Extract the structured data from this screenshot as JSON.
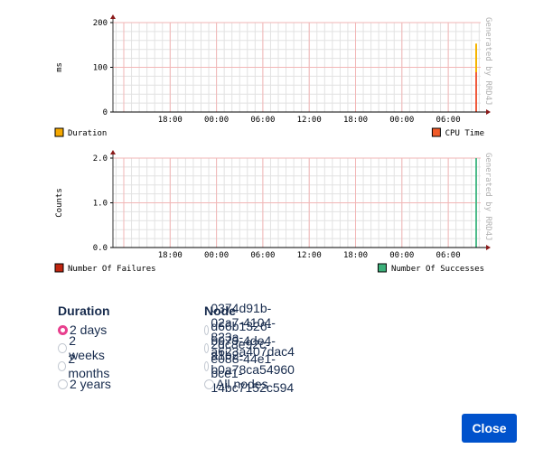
{
  "chart_data": [
    {
      "type": "line",
      "title": "",
      "ylabel": "ms",
      "xlabel": "",
      "ylim": [
        0,
        200
      ],
      "yticks": [
        "0",
        "100",
        "200"
      ],
      "xticks": [
        "18:00",
        "00:00",
        "06:00",
        "12:00",
        "18:00",
        "00:00",
        "06:00"
      ],
      "watermark": "Generated by RRD4J",
      "series": [
        {
          "name": "Duration",
          "color": "#f5b400",
          "points": [
            {
              "x": "latest",
              "y": 153
            }
          ]
        },
        {
          "name": "CPU Time",
          "color": "#f05a3c",
          "points": [
            {
              "x": "latest",
              "y": 89
            }
          ]
        }
      ],
      "legend": [
        {
          "label": "Duration",
          "color": "#f5a800",
          "position": "bottom-left"
        },
        {
          "label": "CPU Time",
          "color": "#f05a28",
          "position": "bottom-right"
        }
      ],
      "grid": true
    },
    {
      "type": "line",
      "title": "",
      "ylabel": "Counts",
      "xlabel": "",
      "ylim": [
        0,
        2
      ],
      "yticks": [
        "0.0",
        "1.0",
        "2.0"
      ],
      "xticks": [
        "18:00",
        "00:00",
        "06:00",
        "12:00",
        "18:00",
        "00:00",
        "06:00"
      ],
      "watermark": "Generated by RRD4J",
      "series": [
        {
          "name": "Number Of Failures",
          "color": "#c0250f",
          "points": [
            {
              "x": "latest",
              "y": 0
            }
          ]
        },
        {
          "name": "Number Of Successes",
          "color": "#4dbb8a",
          "points": [
            {
              "x": "latest",
              "y": 2
            }
          ]
        }
      ],
      "legend": [
        {
          "label": "Number Of Failures",
          "color": "#c0250f",
          "position": "bottom-left"
        },
        {
          "label": "Number Of Successes",
          "color": "#3cb07a",
          "position": "bottom-right"
        }
      ],
      "grid": true
    }
  ],
  "duration": {
    "heading": "Duration",
    "options": [
      {
        "label": "2 days",
        "selected": true
      },
      {
        "label": "2 weeks",
        "selected": false
      },
      {
        "label": "2 months",
        "selected": false
      },
      {
        "label": "2 years",
        "selected": false
      }
    ]
  },
  "node": {
    "heading": "Node",
    "options": [
      {
        "label": "0374d91b-02a7-4104-823a-a623a407dac4",
        "selected": false
      },
      {
        "label": "d66b1326-b079-4de4-a1b2-b0a78ca54960",
        "selected": false
      },
      {
        "label": "2dc8e92c-e088-44e1-bce1-14bc7152c594",
        "selected": false
      },
      {
        "label": "All nodes",
        "selected": false
      }
    ]
  },
  "buttons": {
    "close": "Close"
  }
}
